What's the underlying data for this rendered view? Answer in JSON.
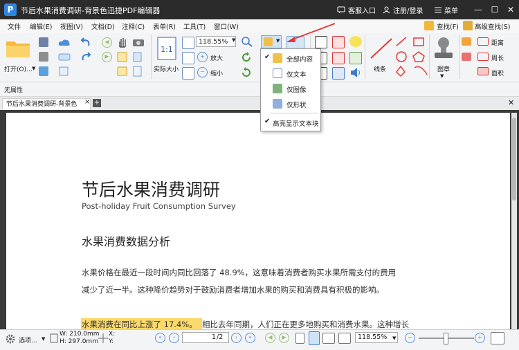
{
  "title_bar": {
    "app_logo": "P",
    "title": "节后水果消费调研-背景色迅捷PDF编辑器",
    "service_entry": "客服入口",
    "login": "注册/登录",
    "menu": "菜单",
    "controls": {
      "minimize": "—",
      "maximize": "☐",
      "close": "✕"
    }
  },
  "menu_bar": {
    "items": [
      "文件",
      "编辑(E)",
      "视图(V)",
      "文档(D)",
      "注释(C)",
      "表单(R)",
      "工具(T)",
      "窗口(W)"
    ],
    "right": {
      "find": "查找(F)",
      "advanced_find": "高级查找(S)"
    }
  },
  "ribbon": {
    "open_label": "打开(O)...",
    "actual_size_label": "实际大小",
    "zoom_value": "118.55%",
    "zoom_in_label": "放大",
    "zoom_out_label": "缩小",
    "line_label": "线条",
    "stamp_label": "图章",
    "distance_label": "距离",
    "perimeter_label": "周长",
    "area_label": "面积"
  },
  "property_bar": {
    "label": "无属性"
  },
  "tab_bar": {
    "tab_title": "节后水果消费调研-背景色",
    "close": "×",
    "add": "+"
  },
  "select_dropdown": {
    "items": [
      {
        "label": "全部内容",
        "checked": true
      },
      {
        "label": "仅文本",
        "checked": false
      },
      {
        "label": "仅图像",
        "checked": false
      },
      {
        "label": "仅形状",
        "checked": false
      }
    ],
    "highlight_item": {
      "label": "高亮显示文本块",
      "checked": true
    }
  },
  "document": {
    "title": "节后水果消费调研",
    "subtitle": "Post-holiday Fruit Consumption Survey",
    "heading": "水果消费数据分析",
    "para1_line1": "水果价格在最近一段时间内同比回落了  48.9%，这意味着消费者购买水果所需支付的费用",
    "para1_line2": "减少了近一半。这种降价趋势对于鼓励消费者增加水果的购买和消费具有积极的影响。",
    "para2_highlight": "水果消费在同比上涨了 17.4%。",
    "para2_rest": "相比去年同期，人们正在更多地购买和消费水果。这种增长"
  },
  "status_bar": {
    "select_label": "选项...",
    "width": "W: 210.0mm",
    "height": "H: 297.0mm",
    "x": "X:",
    "y": "Y:",
    "page_current": "1",
    "page_total": "/2",
    "zoom_value": "118.55%"
  },
  "colors": {
    "accent": "#2f86e0",
    "title_bar": "#2b2b2b",
    "highlight": "#fbd96b",
    "arrow": "#e53935"
  }
}
